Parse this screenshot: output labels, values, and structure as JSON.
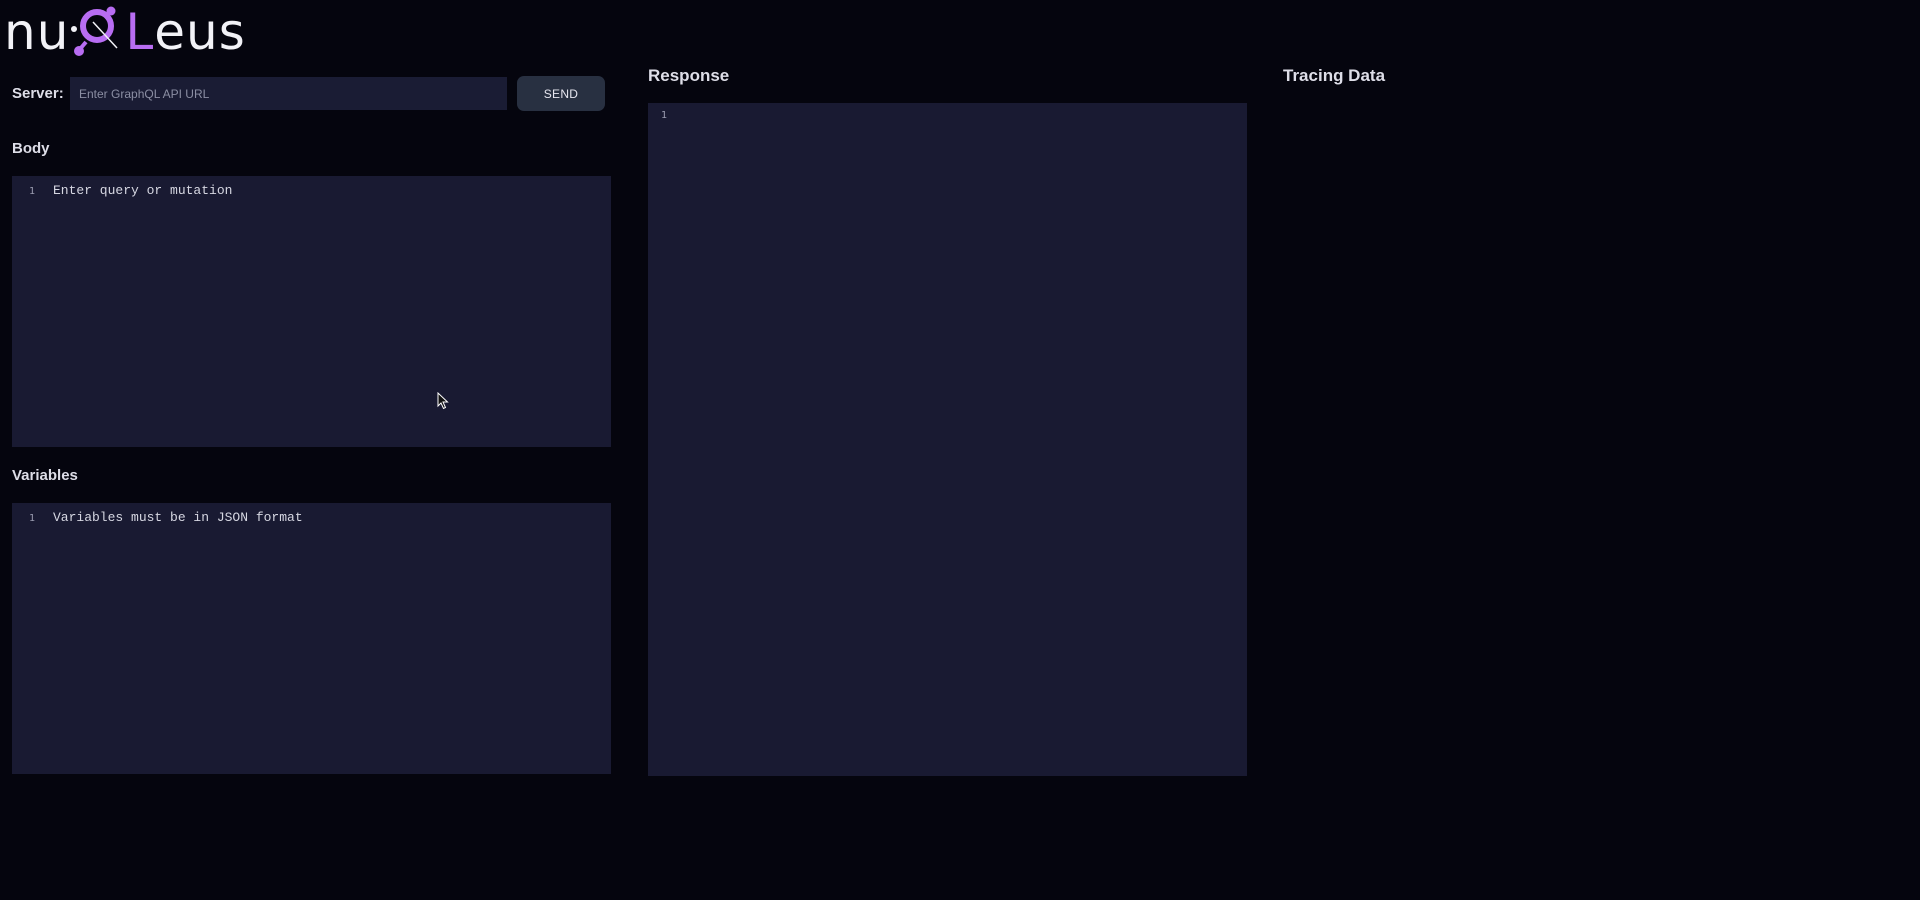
{
  "app": {
    "logo": {
      "part1": "nu",
      "part2": "L",
      "part3": "eus"
    }
  },
  "server": {
    "label": "Server:",
    "input_placeholder": "Enter GraphQL API URL",
    "input_value": "",
    "send_label": "SEND"
  },
  "body": {
    "title": "Body",
    "line_number": "1",
    "placeholder": "Enter query or mutation"
  },
  "variables": {
    "title": "Variables",
    "line_number": "1",
    "placeholder": "Variables must be in JSON format"
  },
  "response": {
    "title": "Response",
    "line_number": "1"
  },
  "tracing": {
    "title": "Tracing Data"
  },
  "colors": {
    "background": "#05050e",
    "editor_background": "#191a32",
    "accent": "#b86df2",
    "button_background": "#283041"
  },
  "icons": {
    "logo_mark": "magnifying-glass-molecule-icon",
    "cursor": "mouse-pointer-icon"
  }
}
